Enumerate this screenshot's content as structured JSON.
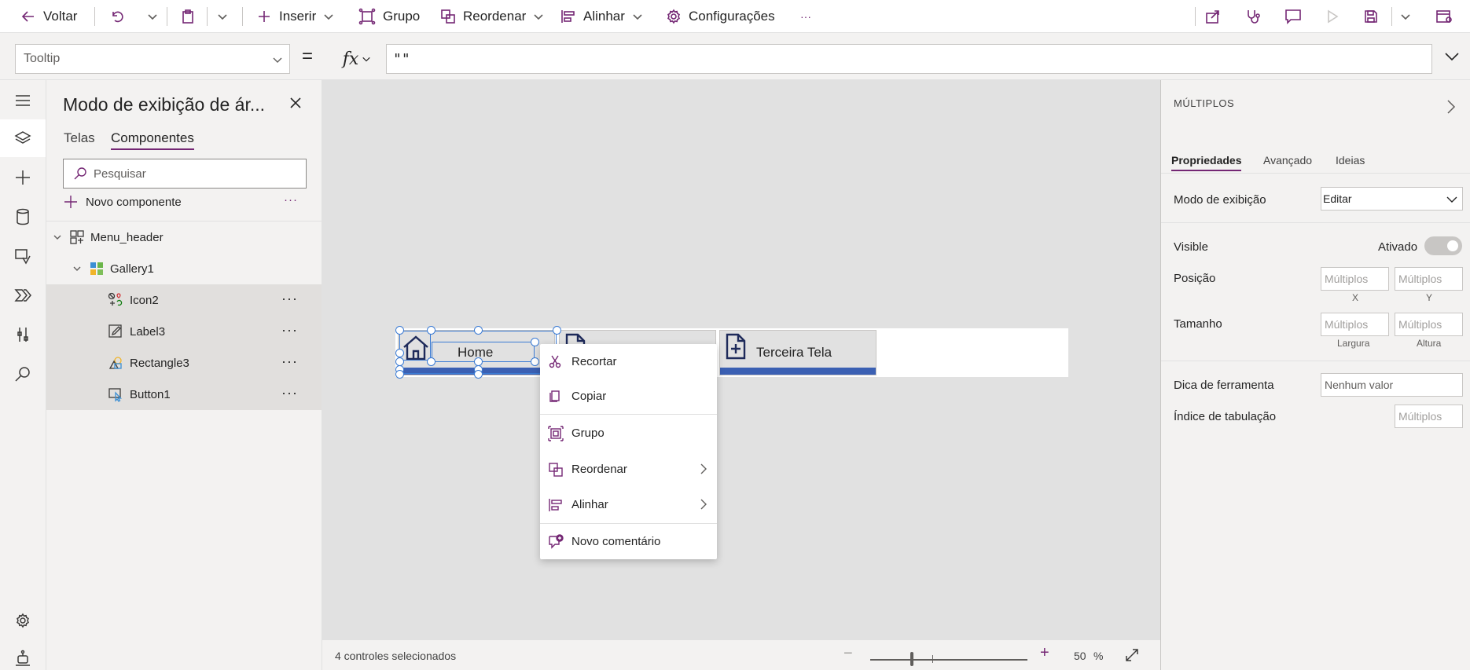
{
  "toolbar": {
    "back_label": "Voltar",
    "insert_label": "Inserir",
    "group_label": "Grupo",
    "reorder_label": "Reordenar",
    "align_label": "Alinhar",
    "settings_label": "Configurações",
    "more_label": "···"
  },
  "formula_bar": {
    "property": "Tooltip",
    "equals": "=",
    "fx": "fx",
    "formula": "\"\""
  },
  "tree": {
    "title": "Modo de exibição de ár...",
    "tabs": [
      "Telas",
      "Componentes"
    ],
    "search_placeholder": "Pesquisar",
    "new_component_label": "Novo componente",
    "more": "···",
    "items": [
      {
        "label": "Menu_header"
      },
      {
        "label": "Gallery1"
      },
      {
        "label": "Icon2",
        "more": "···"
      },
      {
        "label": "Label3",
        "more": "···"
      },
      {
        "label": "Rectangle3",
        "more": "···"
      },
      {
        "label": "Button1",
        "more": "···"
      }
    ]
  },
  "canvas": {
    "items": [
      {
        "label": "Home"
      },
      {
        "label": "Terceira Tela"
      }
    ]
  },
  "context_menu": {
    "items": [
      {
        "label": "Recortar"
      },
      {
        "label": "Copiar"
      },
      {
        "label": "Grupo"
      },
      {
        "label": "Reordenar"
      },
      {
        "label": "Alinhar"
      },
      {
        "label": "Novo comentário"
      }
    ]
  },
  "status": {
    "selected_text": "4 controles selecionados",
    "zoom_minus": "−",
    "zoom_plus": "+",
    "zoom_value": "50",
    "zoom_unit": "%"
  },
  "props": {
    "header": "MÚLTIPLOS",
    "tabs": [
      "Propriedades",
      "Avançado",
      "Ideias"
    ],
    "display_mode_label": "Modo de exibição",
    "display_mode_value": "Editar",
    "visible_label": "Visible",
    "visible_value": "Ativado",
    "position_label": "Posição",
    "position_x_placeholder": "Múltiplos",
    "position_y_placeholder": "Múltiplos",
    "position_x_caption": "X",
    "position_y_caption": "Y",
    "size_label": "Tamanho",
    "width_placeholder": "Múltiplos",
    "height_placeholder": "Múltiplos",
    "width_caption": "Largura",
    "height_caption": "Altura",
    "tooltip_label": "Dica de ferramenta",
    "tooltip_placeholder": "Nenhum valor",
    "tabindex_label": "Índice de tabulação",
    "tabindex_placeholder": "Múltiplos"
  },
  "colors": {
    "accent": "#742774",
    "selection": "#3b7bd4",
    "gallery_underline": "#3b60b3"
  }
}
